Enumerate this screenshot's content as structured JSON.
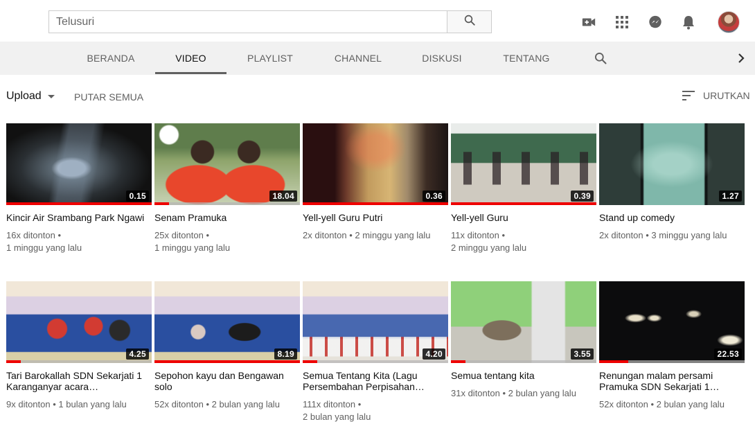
{
  "search": {
    "placeholder": "Telusuri"
  },
  "tabs": [
    {
      "label": "BERANDA",
      "active": false
    },
    {
      "label": "VIDEO",
      "active": true
    },
    {
      "label": "PLAYLIST",
      "active": false
    },
    {
      "label": "CHANNEL",
      "active": false
    },
    {
      "label": "DISKUSI",
      "active": false
    },
    {
      "label": "TENTANG",
      "active": false
    }
  ],
  "toolbar": {
    "upload_label": "Upload",
    "play_all_label": "PUTAR SEMUA",
    "sort_label": "URUTKAN"
  },
  "colors": {
    "accent": "#ff0000",
    "tab_bg": "#f1f1f1",
    "meta_text": "#606060"
  },
  "icons": [
    "search-icon",
    "video-camera-add-icon",
    "apps-grid-icon",
    "messages-icon",
    "notifications-bell-icon",
    "tab-search-icon",
    "chevron-right-icon",
    "sort-icon"
  ],
  "videos": [
    {
      "title": "Kincir Air Srambang Park Ngawi",
      "views": "16x ditonton",
      "age": "1 minggu yang lalu",
      "duration": "0.15",
      "watched": 1.0
    },
    {
      "title": "Senam Pramuka",
      "views": "25x ditonton",
      "age": "1 minggu yang lalu",
      "duration": "18.04",
      "watched": 0.1
    },
    {
      "title": "Yell-yell Guru Putri",
      "views": "2x ditonton",
      "age": "2 minggu yang lalu",
      "duration": "0.36",
      "watched": 1.0
    },
    {
      "title": "Yell-yell Guru",
      "views": "11x ditonton",
      "age": "2 minggu yang lalu",
      "duration": "0.39",
      "watched": 1.0
    },
    {
      "title": "Stand up comedy",
      "views": "2x ditonton",
      "age": "3 minggu yang lalu",
      "duration": "1.27",
      "watched": 0
    },
    {
      "title": "Tari Barokallah SDN Sekarjati 1 Karanganyar acara…",
      "views": "9x ditonton",
      "age": "1 bulan yang lalu",
      "duration": "4.25",
      "watched": 0.1
    },
    {
      "title": "Sepohon kayu dan Bengawan solo",
      "views": "52x ditonton",
      "age": "2 bulan yang lalu",
      "duration": "8.19",
      "watched": 1.0
    },
    {
      "title": "Semua Tentang Kita (Lagu Persembahan Perpisahan…",
      "views": "111x ditonton",
      "age": "2 bulan yang lalu",
      "duration": "4.20",
      "watched": 0.1
    },
    {
      "title": "Semua tentang kita",
      "views": "31x ditonton",
      "age": "2 bulan yang lalu",
      "duration": "3.55",
      "watched": 0.1
    },
    {
      "title": "Renungan malam persami Pramuka SDN Sekarjati 1…",
      "views": "52x ditonton",
      "age": "2 bulan yang lalu",
      "duration": "22.53",
      "watched": 0.2
    }
  ]
}
